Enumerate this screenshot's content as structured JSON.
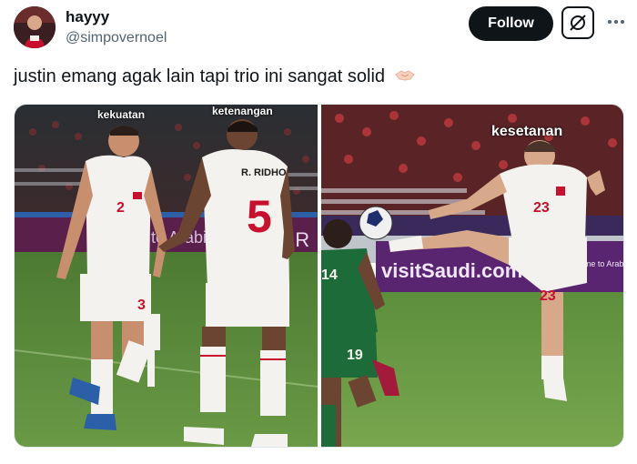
{
  "user": {
    "name": "hayyy",
    "handle": "@simpovernoel"
  },
  "actions": {
    "follow_label": "Follow"
  },
  "icons": {
    "grok": "grok-icon",
    "more": "more-options-icon",
    "emoji": "handshake-emoji"
  },
  "tweet": {
    "text": "justin emang agak lain tapi trio ini sangat solid"
  },
  "media": {
    "left_captions": [
      "kekuatan",
      "ketenangan"
    ],
    "right_caption": "kesetanan",
    "left_jerseys": [
      {
        "name": "",
        "number": "2"
      },
      {
        "name": "R. RIDHO",
        "number": "5"
      },
      {
        "name": "",
        "number": "3"
      }
    ],
    "right_jerseys": [
      {
        "name": "",
        "number": "23"
      },
      {
        "name": "",
        "number": "23"
      },
      {
        "name": "",
        "number": "19"
      },
      {
        "name": "",
        "number": "14"
      }
    ],
    "board_texts": [
      "visitSaudi.com",
      "Welcome to Arabia"
    ]
  },
  "colors": {
    "follow_bg": "#0f1419",
    "handle_gray": "#536471",
    "pitch_green": "#5a8a3c",
    "jersey_white": "#f4f2ee",
    "jersey_red": "#c8102e",
    "opponent_green": "#1e6b3a"
  }
}
